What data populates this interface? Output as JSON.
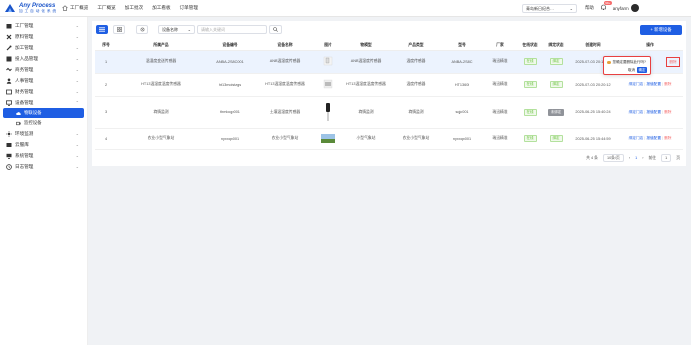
{
  "app": {
    "title": "Any Process",
    "subtitle": "加 工 自 动 化 系 统"
  },
  "topnav": [
    "工厂概览",
    "工厂概览",
    "加工批次",
    "加工看板",
    "订单管理"
  ],
  "site_select": "青岛新日纪合…",
  "topright": {
    "help": "帮助",
    "badge": "99+",
    "user": "anyfarm"
  },
  "sidebar": {
    "items": [
      {
        "label": "工厂管理",
        "icon": "factory-icon"
      },
      {
        "label": "原料管理",
        "icon": "material-icon"
      },
      {
        "label": "加工管理",
        "icon": "wrench-icon"
      },
      {
        "label": "投入品管理",
        "icon": "box-icon"
      },
      {
        "label": "商务管理",
        "icon": "handshake-icon"
      },
      {
        "label": "人事管理",
        "icon": "person-icon"
      },
      {
        "label": "财务管理",
        "icon": "wallet-icon"
      },
      {
        "label": "设备管理",
        "icon": "monitor-icon"
      }
    ],
    "sub_items": [
      {
        "label": "物联设备",
        "active": true
      },
      {
        "label": "监控设备",
        "active": false
      }
    ],
    "items_after": [
      {
        "label": "环境监测",
        "icon": "env-icon"
      },
      {
        "label": "云服库",
        "icon": "cloud-icon"
      },
      {
        "label": "系统管理",
        "icon": "settings-icon"
      },
      {
        "label": "日志管理",
        "icon": "log-icon"
      }
    ]
  },
  "toolbar": {
    "field_select": "设备名称",
    "search_placeholder": "请输入关键词",
    "add_label": "+ 新增设备"
  },
  "table": {
    "headers": [
      "序号",
      "所属产品",
      "设备编号",
      "设备名称",
      "图片",
      "物模型",
      "产品类型",
      "型号",
      "厂家",
      "在线状态",
      "绑定状态",
      "创建时间",
      "操作"
    ],
    "rows": [
      {
        "no": "1",
        "product": "温湿度变送传感器",
        "code": "ANBA-2S8C001",
        "name": "ANB温湿度传感器",
        "model": "ANB温湿度传感器",
        "ptype": "温度传感器",
        "type": "ANBA-2S8C",
        "maker": "瑞迅精准",
        "online": "在线",
        "bind": "绑定",
        "time": "2025-07-03 20:17:47"
      },
      {
        "no": "2",
        "product": "HT13温湿度温度传感器",
        "code": "ht13moistzgs",
        "name": "HT13温湿度温度传感器",
        "model": "HT13温湿度温度传感器",
        "ptype": "温度传感器",
        "type": "HT1360l",
        "maker": "瑞迅精准",
        "online": "在线",
        "bind": "绑定",
        "time": "2025-07-03 20:20:12"
      },
      {
        "no": "3",
        "product": "墒情监测",
        "code": "thmloqp001",
        "name": "土壤温湿度传感器",
        "model": "墒情监测",
        "ptype": "墒情监测",
        "type": "sqjc001",
        "maker": "瑞迅精准",
        "online": "在线",
        "bind": "未绑定",
        "time": "2025-06-25 15:40:24"
      },
      {
        "no": "4",
        "product": "农业小型气象站",
        "code": "nyxxqx001",
        "name": "农业小型气象站",
        "model": "小型气象站",
        "ptype": "农业小型气象站",
        "type": "nyxxqx001",
        "maker": "瑞迅精准",
        "online": "在线",
        "bind": "绑定",
        "time": "2025-06-25 15:44:59"
      }
    ],
    "actions": {
      "bind": "绑定门店",
      "config": "报值配置",
      "delete": "删除"
    }
  },
  "popconfirm": {
    "message": "您确定要删除此行吗?",
    "cancel": "取消",
    "ok": "确定"
  },
  "pager": {
    "total": "共 4 条",
    "size": "10条/页",
    "page": "1",
    "goto": "前往",
    "goto_value": "1",
    "unit": "页"
  }
}
